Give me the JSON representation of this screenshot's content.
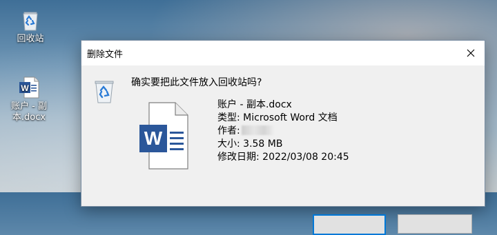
{
  "desktop": {
    "icons": [
      {
        "label": "回收站",
        "icon": "recycle-bin-icon"
      },
      {
        "label": "账户 - 副本.docx",
        "icon": "word-doc-icon"
      }
    ]
  },
  "dialog": {
    "title": "删除文件",
    "question": "确实要把此文件放入回收站吗?",
    "file": {
      "name_label": "账户 - 副本.docx",
      "type_label": "类型: Microsoft Word 文档",
      "author_label": "作者:",
      "size_label": "大小: 3.58 MB",
      "modified_label": "修改日期: 2022/03/08 20:45"
    },
    "buttons": {
      "yes": "",
      "no": ""
    }
  },
  "colors": {
    "word_blue": "#2b579a",
    "accent": "#0078d7",
    "recycle_blue": "#2a7bd6"
  }
}
